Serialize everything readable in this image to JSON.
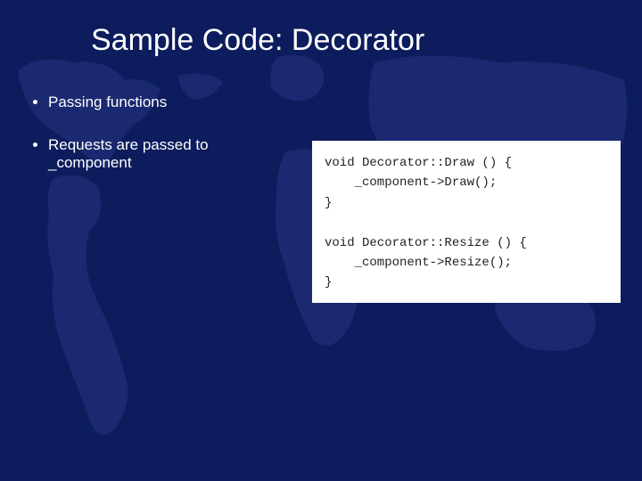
{
  "title": "Sample Code: Decorator",
  "bullets": [
    "Passing functions",
    "Requests are passed to _component"
  ],
  "code": "void Decorator::Draw () {\n    _component->Draw();\n}\n\nvoid Decorator::Resize () {\n    _component->Resize();\n}"
}
